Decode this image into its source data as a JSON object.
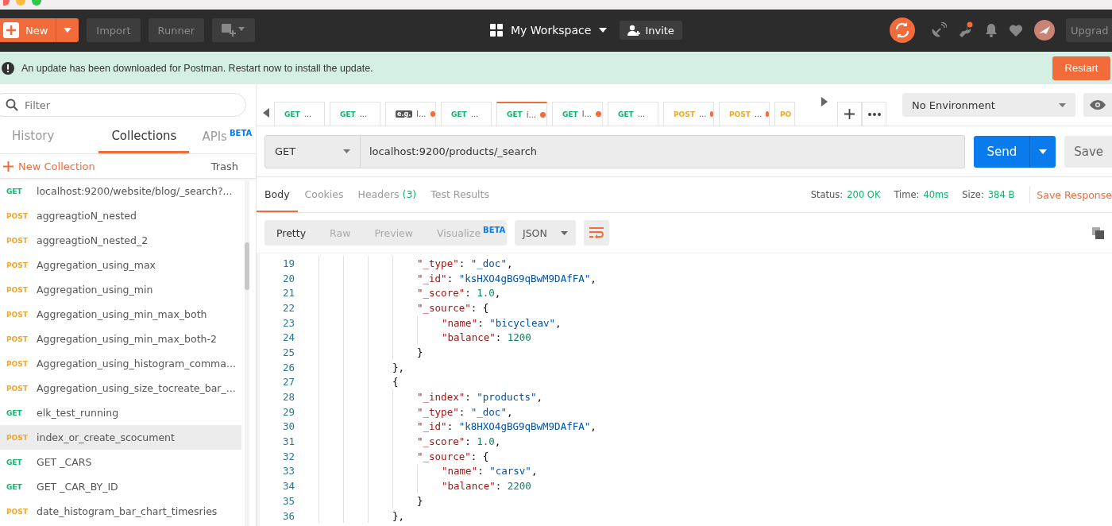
{
  "toolbar": {
    "new_button": "New",
    "import_button": "Import",
    "runner_button": "Runner",
    "workspace": "My Workspace",
    "invite_button": "Invite",
    "upgrade_button": "Upgrad"
  },
  "banner": {
    "message": "An update has been downloaded for Postman. Restart now to install the update.",
    "restart_button": "Restart"
  },
  "sidebar": {
    "filter_placeholder": "Filter",
    "tabs": [
      {
        "label": "History",
        "selected": false
      },
      {
        "label": "Collections",
        "selected": true
      },
      {
        "label": "APIs",
        "badge": "BETA",
        "selected": false
      }
    ],
    "new_collection": "New Collection",
    "trash": "Trash",
    "items": [
      {
        "method": "GET",
        "name": "localhost:9200/website/blog/_search?...",
        "selected": false
      },
      {
        "method": "POST",
        "name": "aggreagtioN_nested",
        "selected": false
      },
      {
        "method": "POST",
        "name": "aggreagtioN_nested_2",
        "selected": false
      },
      {
        "method": "POST",
        "name": "Aggregation_using_max",
        "selected": false
      },
      {
        "method": "POST",
        "name": "Aggregation_using_min",
        "selected": false
      },
      {
        "method": "POST",
        "name": "Aggregation_using_min_max_both",
        "selected": false
      },
      {
        "method": "POST",
        "name": "Aggregation_using_min_max_both-2",
        "selected": false
      },
      {
        "method": "POST",
        "name": "Aggregation_using_histogram_comma...",
        "selected": false
      },
      {
        "method": "POST",
        "name": "Aggregation_using_size_tocreate_bar_...",
        "selected": false
      },
      {
        "method": "GET",
        "name": "elk_test_running",
        "selected": false
      },
      {
        "method": "POST",
        "name": "index_or_create_scocument",
        "selected": true
      },
      {
        "method": "GET",
        "name": "GET _CARS",
        "selected": false
      },
      {
        "method": "GET",
        "name": "GET _CAR_BY_ID",
        "selected": false
      },
      {
        "method": "POST",
        "name": "date_histogram_bar_chart_timesries",
        "selected": false
      }
    ]
  },
  "request_tabs": [
    {
      "kind": "request",
      "method": "GET",
      "label": "...",
      "unsaved": false,
      "selected": false
    },
    {
      "kind": "request",
      "method": "GET",
      "label": "...",
      "unsaved": false,
      "selected": false
    },
    {
      "kind": "example",
      "method": "e.g.",
      "label": "l...",
      "unsaved": true,
      "selected": false
    },
    {
      "kind": "request",
      "method": "GET",
      "label": "...",
      "unsaved": false,
      "selected": false
    },
    {
      "kind": "request",
      "method": "GET",
      "label": "i...",
      "unsaved": true,
      "selected": true
    },
    {
      "kind": "request",
      "method": "GET",
      "label": "l...",
      "unsaved": true,
      "selected": false
    },
    {
      "kind": "request",
      "method": "GET",
      "label": "...",
      "unsaved": false,
      "selected": false
    },
    {
      "kind": "request",
      "method": "POST",
      "label": "...",
      "unsaved": true,
      "selected": false
    },
    {
      "kind": "request",
      "method": "POST",
      "label": "...",
      "unsaved": true,
      "selected": false
    },
    {
      "kind": "request",
      "method": "PO",
      "unsaved": false,
      "selected": false
    }
  ],
  "environment": "No Environment",
  "request": {
    "method": "GET",
    "url": "localhost:9200/products/_search",
    "send_button": "Send",
    "save_button": "Save"
  },
  "response": {
    "tabs": [
      {
        "label": "Body",
        "selected": true
      },
      {
        "label": "Cookies",
        "selected": false
      },
      {
        "label": "Headers",
        "count": "(3)",
        "selected": false
      },
      {
        "label": "Test Results",
        "selected": false
      }
    ],
    "status_label": "Status:",
    "status": "200 OK",
    "time_label": "Time:",
    "time": "40ms",
    "size_label": "Size:",
    "size": "384 B",
    "save_response": "Save Response",
    "views": [
      {
        "label": "Pretty",
        "selected": true
      },
      {
        "label": "Raw",
        "selected": false
      },
      {
        "label": "Preview",
        "selected": false
      },
      {
        "label": "Visualize",
        "badge": "BETA",
        "selected": false
      }
    ],
    "format": "JSON",
    "code_lines": [
      {
        "number": "19",
        "code": "                \"_type\": \"_doc\","
      },
      {
        "number": "20",
        "code": "                \"_id\": \"ksHXO4gBG9qBwM9DAfFA\","
      },
      {
        "number": "21",
        "code": "                \"_score\": 1.0,"
      },
      {
        "number": "22",
        "code": "                \"_source\": {"
      },
      {
        "number": "23",
        "code": "                    \"name\": \"bicycleav\","
      },
      {
        "number": "24",
        "code": "                    \"balance\": 1200"
      },
      {
        "number": "25",
        "code": "                }"
      },
      {
        "number": "26",
        "code": "            },"
      },
      {
        "number": "27",
        "code": "            {"
      },
      {
        "number": "28",
        "code": "                \"_index\": \"products\","
      },
      {
        "number": "29",
        "code": "                \"_type\": \"_doc\","
      },
      {
        "number": "30",
        "code": "                \"_id\": \"k8HXO4gBG9qBwM9DAfFA\","
      },
      {
        "number": "31",
        "code": "                \"_score\": 1.0,"
      },
      {
        "number": "32",
        "code": "                \"_source\": {"
      },
      {
        "number": "33",
        "code": "                    \"name\": \"carsv\","
      },
      {
        "number": "34",
        "code": "                    \"balance\": 2200"
      },
      {
        "number": "35",
        "code": "                }"
      },
      {
        "number": "36",
        "code": "            },"
      }
    ]
  }
}
